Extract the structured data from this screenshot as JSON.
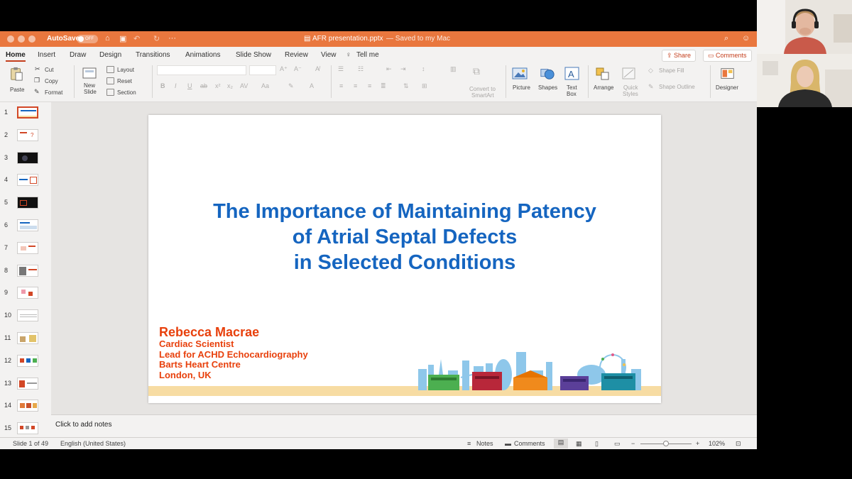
{
  "window": {
    "autosave_label": "AutoSave",
    "autosave_state": "OFF",
    "title": "AFR presentation.pptx",
    "saved_status": "— Saved to my Mac"
  },
  "tabs": [
    "Home",
    "Insert",
    "Draw",
    "Design",
    "Transitions",
    "Animations",
    "Slide Show",
    "Review",
    "View"
  ],
  "tell_me": "Tell me",
  "share_label": "Share",
  "comments_label": "Comments",
  "ribbon": {
    "paste": "Paste",
    "cut": "Cut",
    "copy": "Copy",
    "format": "Format",
    "new_slide": [
      "New",
      "Slide"
    ],
    "layout": "Layout",
    "reset": "Reset",
    "section": "Section",
    "convert": [
      "Convert to",
      "SmartArt"
    ],
    "picture": "Picture",
    "shapes": "Shapes",
    "text_box": [
      "Text",
      "Box"
    ],
    "arrange": "Arrange",
    "quick_styles": [
      "Quick",
      "Styles"
    ],
    "shape_fill": "Shape Fill",
    "shape_outline": "Shape Outline",
    "designer": "Designer"
  },
  "thumbnails": [
    "1",
    "2",
    "3",
    "4",
    "5",
    "6",
    "7",
    "8",
    "9",
    "10",
    "11",
    "12",
    "13",
    "14",
    "15"
  ],
  "slide": {
    "title_lines": [
      "The Importance of Maintaining Patency",
      "of Atrial Septal Defects",
      "in Selected Conditions"
    ],
    "author_name": "Rebecca Macrae",
    "author_lines": [
      "Cardiac Scientist",
      "Lead for ACHD Echocardiography",
      "Barts Heart Centre",
      "London, UK"
    ]
  },
  "notes_placeholder": "Click to add notes",
  "status": {
    "slide_count": "Slide 1 of 49",
    "language": "English (United States)",
    "notes": "Notes",
    "comments": "Comments",
    "zoom": "102%"
  },
  "colors": {
    "titlebar": "#e9773e",
    "slide_title": "#1565c0",
    "author": "#e8400c",
    "accent": "#c43e1c"
  }
}
